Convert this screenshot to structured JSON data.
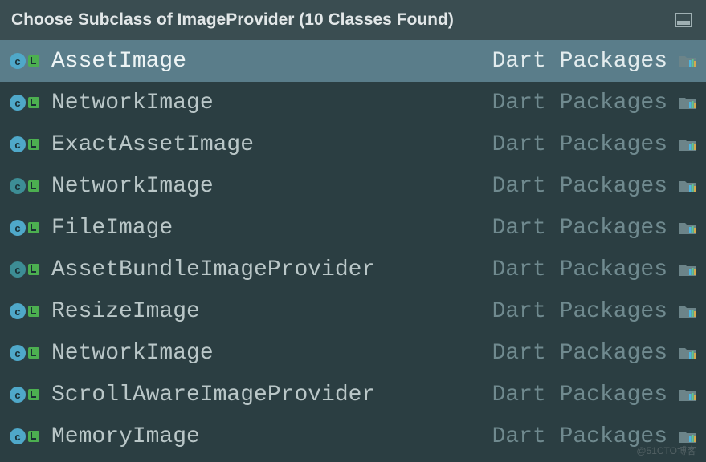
{
  "titlebar": {
    "text": "Choose Subclass of ImageProvider (10 Classes Found)"
  },
  "items": [
    {
      "name": "AssetImage",
      "location": "Dart Packages",
      "iconVariant": "c-blue",
      "selected": true
    },
    {
      "name": "NetworkImage",
      "location": "Dart Packages",
      "iconVariant": "c-blue",
      "selected": false
    },
    {
      "name": "ExactAssetImage",
      "location": "Dart Packages",
      "iconVariant": "c-blue",
      "selected": false
    },
    {
      "name": "NetworkImage",
      "location": "Dart Packages",
      "iconVariant": "c-teal",
      "selected": false
    },
    {
      "name": "FileImage",
      "location": "Dart Packages",
      "iconVariant": "c-blue",
      "selected": false
    },
    {
      "name": "AssetBundleImageProvider",
      "location": "Dart Packages",
      "iconVariant": "c-teal",
      "selected": false
    },
    {
      "name": "ResizeImage",
      "location": "Dart Packages",
      "iconVariant": "c-blue",
      "selected": false
    },
    {
      "name": "NetworkImage",
      "location": "Dart Packages",
      "iconVariant": "c-blue",
      "selected": false
    },
    {
      "name": "ScrollAwareImageProvider",
      "location": "Dart Packages",
      "iconVariant": "c-blue",
      "selected": false
    },
    {
      "name": "MemoryImage",
      "location": "Dart Packages",
      "iconVariant": "c-blue",
      "selected": false
    }
  ],
  "watermark": "@51CTO博客"
}
